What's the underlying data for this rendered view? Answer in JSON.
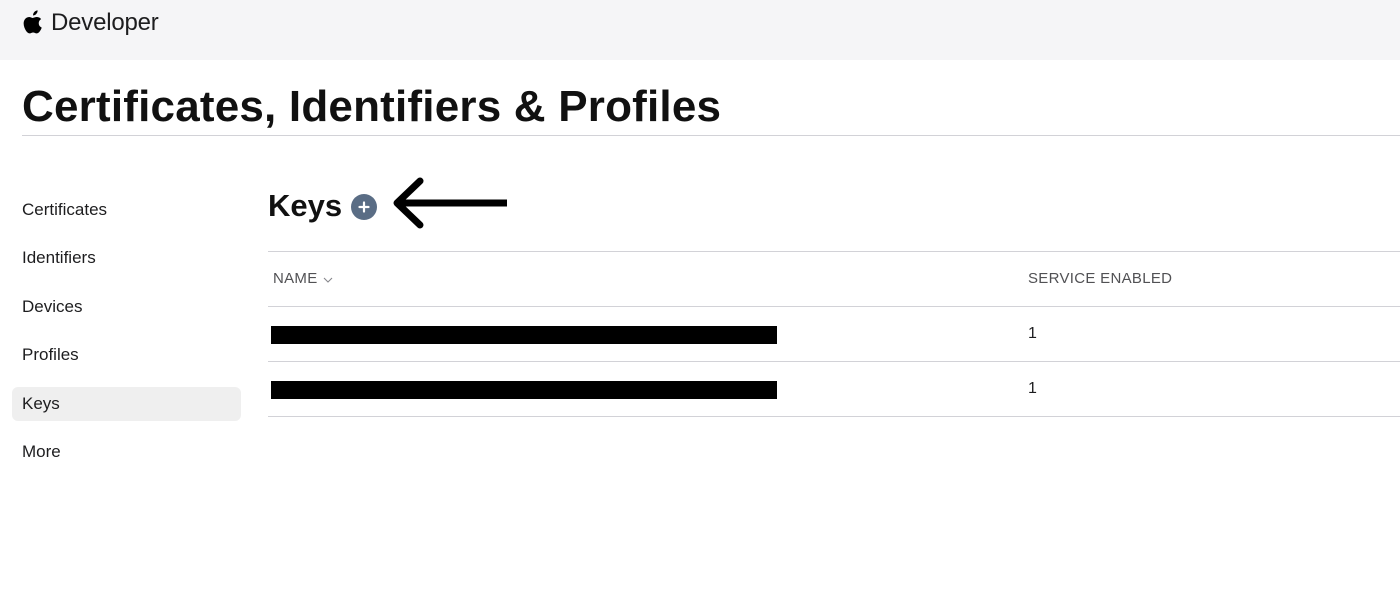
{
  "header": {
    "brand_label": "Developer",
    "logo_icon": "apple-logo-icon"
  },
  "page": {
    "title": "Certificates, Identifiers & Profiles"
  },
  "sidebar": {
    "items": [
      {
        "label": "Certificates",
        "active": false
      },
      {
        "label": "Identifiers",
        "active": false
      },
      {
        "label": "Devices",
        "active": false
      },
      {
        "label": "Profiles",
        "active": false
      },
      {
        "label": "Keys",
        "active": true
      },
      {
        "label": "More",
        "active": false
      }
    ]
  },
  "keys_section": {
    "title": "Keys",
    "add_icon": "plus-circle-icon",
    "annotation_icon": "left-arrow-icon",
    "columns": [
      {
        "label": "NAME",
        "sort_icon": "chevron-down-icon"
      },
      {
        "label": "SERVICE ENABLED"
      }
    ],
    "rows": [
      {
        "name": "",
        "name_redacted": true,
        "service_enabled": "1"
      },
      {
        "name": "",
        "name_redacted": true,
        "service_enabled": "1"
      }
    ]
  },
  "colors": {
    "topbar_bg": "#f5f5f7",
    "add_button_bg": "#5a6d85",
    "active_item_bg": "#efefef",
    "divider": "#d2d2d7",
    "redaction": "#000000"
  }
}
